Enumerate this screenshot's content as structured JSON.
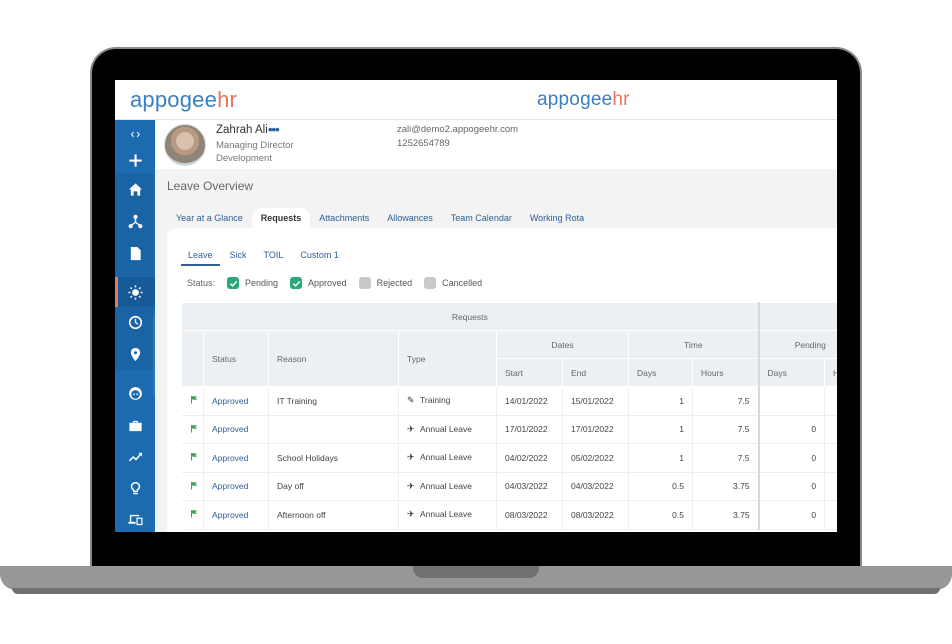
{
  "brand": {
    "prefix": "appogee",
    "suffix": "hr",
    "colors": {
      "primary": "#3a7fc1",
      "accent": "#e8745a",
      "sidebar": "#1c6bb0",
      "check": "#2aa87a"
    }
  },
  "sidebar": {
    "items": [
      {
        "name": "collapse",
        "icon": "code-brackets-icon"
      },
      {
        "name": "add",
        "icon": "plus-icon"
      },
      {
        "name": "home",
        "icon": "home-icon"
      },
      {
        "name": "org-chart",
        "icon": "org-chart-icon"
      },
      {
        "name": "documents",
        "icon": "document-icon"
      },
      {
        "name": "leave",
        "icon": "sun-icon",
        "active": true
      },
      {
        "name": "time",
        "icon": "clock-icon"
      },
      {
        "name": "location",
        "icon": "location-pin-icon"
      },
      {
        "name": "people",
        "icon": "face-icon"
      },
      {
        "name": "jobs",
        "icon": "briefcase-icon"
      },
      {
        "name": "analytics",
        "icon": "trend-icon"
      },
      {
        "name": "ideas",
        "icon": "lightbulb-icon"
      },
      {
        "name": "devices",
        "icon": "devices-icon"
      }
    ]
  },
  "profile": {
    "name": "Zahrah Ali",
    "more": "•••",
    "role": "Managing Director",
    "department": "Development",
    "email": "zali@demo2.appogeehr.com",
    "phone": "1252654789"
  },
  "page": {
    "title": "Leave Overview"
  },
  "tabs": [
    {
      "label": "Year at a Glance"
    },
    {
      "label": "Requests",
      "active": true
    },
    {
      "label": "Attachments"
    },
    {
      "label": "Allowances"
    },
    {
      "label": "Team Calendar"
    },
    {
      "label": "Working Rota"
    }
  ],
  "subtabs": [
    {
      "label": "Leave",
      "active": true
    },
    {
      "label": "Sick"
    },
    {
      "label": "TOIL"
    },
    {
      "label": "Custom 1"
    }
  ],
  "status_filter": {
    "label": "Status:",
    "options": [
      {
        "label": "Pending",
        "checked": true
      },
      {
        "label": "Approved",
        "checked": true
      },
      {
        "label": "Rejected",
        "checked": false
      },
      {
        "label": "Cancelled",
        "checked": false
      }
    ]
  },
  "table": {
    "group_header": "Requests",
    "headers": {
      "status": "Status",
      "reason": "Reason",
      "type": "Type",
      "dates": "Dates",
      "time": "Time",
      "pending": "Pending",
      "start": "Start",
      "end": "End",
      "days": "Days",
      "hours": "Hours",
      "pending_days": "Days",
      "pending_hours": "H"
    },
    "rows": [
      {
        "status": "Approved",
        "reason": "IT Training",
        "type_icon": "pencil-icon",
        "type_glyph": "✎",
        "type": "Training",
        "start": "14/01/2022",
        "end": "15/01/2022",
        "days": "1",
        "hours": "7.5",
        "pending_days": ""
      },
      {
        "status": "Approved",
        "reason": "",
        "type_icon": "plane-icon",
        "type_glyph": "✈",
        "type": "Annual Leave",
        "start": "17/01/2022",
        "end": "17/01/2022",
        "days": "1",
        "hours": "7.5",
        "pending_days": "0"
      },
      {
        "status": "Approved",
        "reason": "School Holidays",
        "type_icon": "plane-icon",
        "type_glyph": "✈",
        "type": "Annual Leave",
        "start": "04/02/2022",
        "end": "05/02/2022",
        "days": "1",
        "hours": "7.5",
        "pending_days": "0"
      },
      {
        "status": "Approved",
        "reason": "Day off",
        "type_icon": "plane-icon",
        "type_glyph": "✈",
        "type": "Annual Leave",
        "start": "04/03/2022",
        "end": "04/03/2022",
        "days": "0.5",
        "hours": "3.75",
        "pending_days": "0"
      },
      {
        "status": "Approved",
        "reason": "Afternoon off",
        "type_icon": "plane-icon",
        "type_glyph": "✈",
        "type": "Annual Leave",
        "start": "08/03/2022",
        "end": "08/03/2022",
        "days": "0.5",
        "hours": "3.75",
        "pending_days": "0"
      }
    ]
  }
}
